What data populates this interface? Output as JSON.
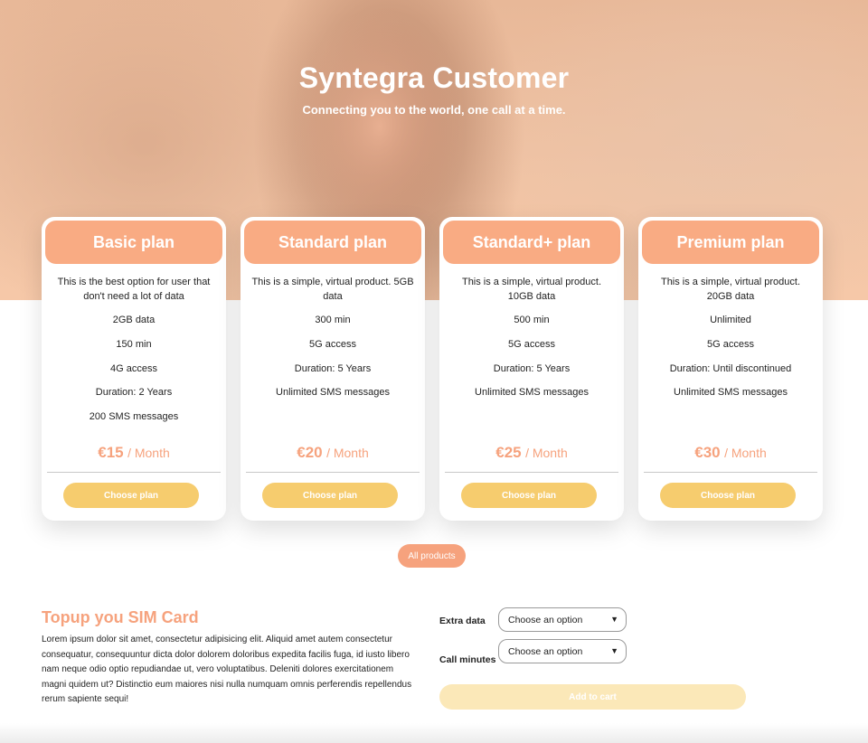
{
  "hero": {
    "title": "Syntegra Customer",
    "subtitle": "Connecting you to the world, one call at a time."
  },
  "plans": [
    {
      "name": "Basic plan",
      "description": "This is the best option for user that don't need a lot of data",
      "features": [
        "2GB data",
        "150 min",
        "4G access",
        "Duration: 2 Years",
        "200 SMS messages"
      ],
      "price": "€15",
      "period": "/ Month",
      "button": "Choose plan"
    },
    {
      "name": "Standard plan",
      "description": "This is a simple, virtual product. 5GB data",
      "features": [
        "300 min",
        "5G access",
        "Duration: 5 Years",
        "Unlimited SMS messages"
      ],
      "price": "€20",
      "period": "/ Month",
      "button": "Choose plan"
    },
    {
      "name": "Standard+ plan",
      "description": "This is a simple, virtual product. 10GB data",
      "features": [
        "500 min",
        "5G access",
        "Duration: 5 Years",
        "Unlimited SMS messages"
      ],
      "price": "€25",
      "period": "/ Month",
      "button": "Choose plan"
    },
    {
      "name": "Premium plan",
      "description": "This is a simple, virtual product. 20GB data",
      "features": [
        "Unlimited",
        "5G access",
        "Duration: Until discontinued",
        "Unlimited SMS messages"
      ],
      "price": "€30",
      "period": "/ Month",
      "button": "Choose plan"
    }
  ],
  "all_products_label": "All products",
  "topup": {
    "title": "Topup you SIM Card",
    "text": "Lorem ipsum dolor sit amet, consectetur adipisicing elit. Aliquid amet autem consectetur consequatur, consequuntur dicta dolor dolorem doloribus expedita facilis fuga, id iusto libero nam neque odio optio repudiandae ut, vero voluptatibus. Deleniti dolores exercitationem magni quidem ut? Distinctio eum maiores nisi nulla numquam omnis perferendis repellendus rerum sapiente sequi!",
    "extra_data_label": "Extra data",
    "extra_data_value": "Choose an option",
    "call_minutes_label": "Call minutes",
    "call_minutes_value": "Choose an option",
    "add_to_cart_label": "Add to cart"
  },
  "colors": {
    "accent": "#f9ab83",
    "price": "#f6a27d",
    "button": "#f6cc6e",
    "button_disabled": "#fbe8b8"
  }
}
